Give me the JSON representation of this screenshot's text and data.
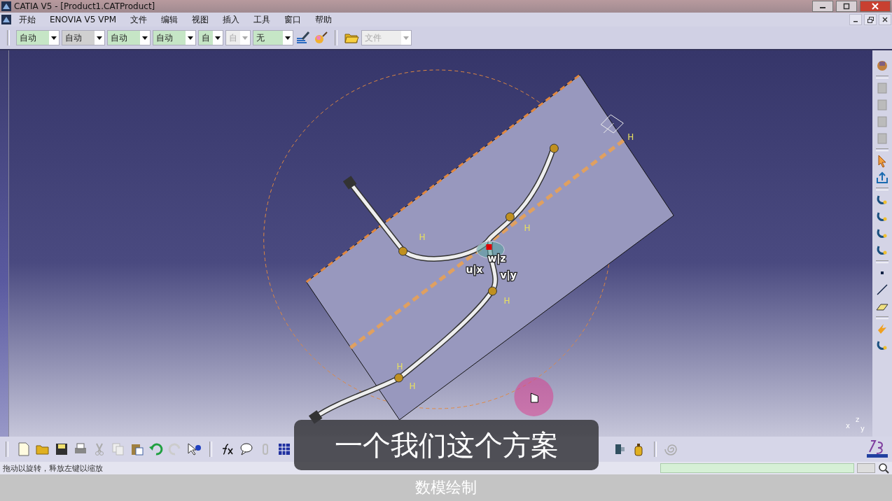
{
  "window": {
    "title": "CATIA V5 - [Product1.CATProduct]"
  },
  "menu": [
    {
      "label": "开始"
    },
    {
      "label": "ENOVIA V5 VPM"
    },
    {
      "label": "文件"
    },
    {
      "label": "编辑"
    },
    {
      "label": "视图"
    },
    {
      "label": "插入"
    },
    {
      "label": "工具"
    },
    {
      "label": "窗口"
    },
    {
      "label": "帮助"
    }
  ],
  "toolbar": {
    "combos": [
      {
        "value": "自动",
        "disabled": false
      },
      {
        "value": "自动",
        "disabled": false
      },
      {
        "value": "自动",
        "disabled": false
      },
      {
        "value": "自动",
        "disabled": false
      },
      {
        "value": "自",
        "disabled": false
      },
      {
        "value": "自",
        "disabled": true
      },
      {
        "value": "无",
        "disabled": false
      }
    ],
    "file_combo": {
      "value": "文件",
      "disabled": true
    }
  },
  "viewport": {
    "handles": [
      {
        "text": "w|z"
      },
      {
        "text": "u|x"
      },
      {
        "text": "v|y"
      }
    ],
    "markers": [
      {
        "text": "H"
      },
      {
        "text": "H"
      },
      {
        "text": "H"
      },
      {
        "text": "H"
      },
      {
        "text": "H"
      },
      {
        "text": "H"
      }
    ],
    "axes": [
      {
        "text": "x"
      },
      {
        "text": "y"
      },
      {
        "text": "z"
      }
    ]
  },
  "status": {
    "text": "拖动以旋转，释放左键以缩放"
  },
  "subtitles": {
    "main": "一个我们这个方案",
    "caption": "数模绘制"
  }
}
